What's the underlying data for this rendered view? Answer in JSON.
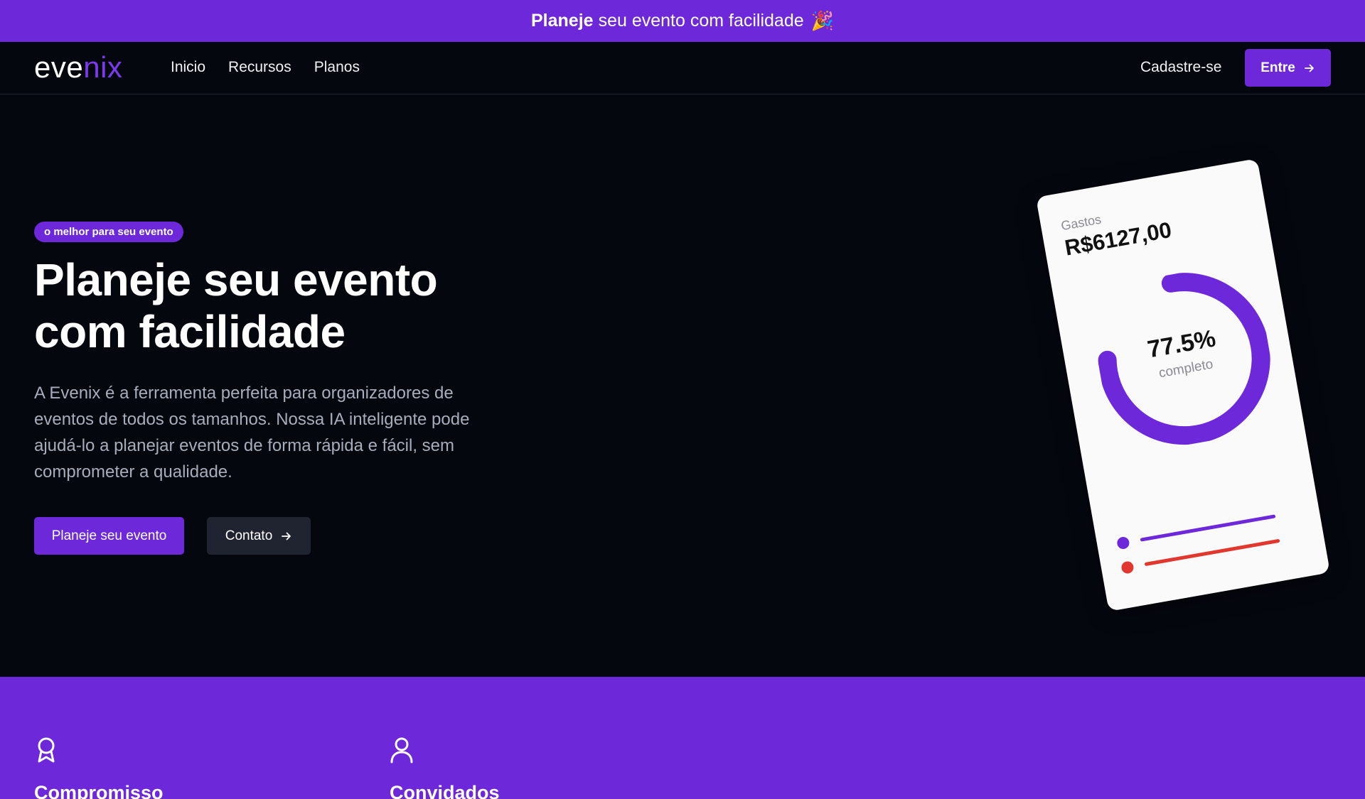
{
  "announcement": {
    "bold": "Planeje",
    "text": "seu evento com facilidade",
    "emoji": "🎉"
  },
  "nav": {
    "logo_part1": "eve",
    "logo_part2": "nix",
    "links": [
      "Inicio",
      "Recursos",
      "Planos"
    ],
    "signup": "Cadastre-se",
    "login": "Entre"
  },
  "hero": {
    "badge": "o melhor para seu evento",
    "title_line1": "Planeje seu evento",
    "title_line2": "com facilidade",
    "description": "A Evenix é a ferramenta perfeita para organizadores de eventos de todos os tamanhos. Nossa IA inteligente pode ajudá-lo a planejar eventos de forma rápida e fácil, sem comprometer a qualidade.",
    "primary_button": "Planeje seu evento",
    "secondary_button": "Contato"
  },
  "card": {
    "label": "Gastos",
    "amount": "R$6127,00",
    "percent_label": "77.5%",
    "percent_value": 77.5,
    "sub_label": "completo",
    "accent": "#6d28d9",
    "legend_colors": [
      "#6d28d9",
      "#e0382e"
    ]
  },
  "features": [
    {
      "icon": "award-icon",
      "title": "Compromisso"
    },
    {
      "icon": "user-icon",
      "title": "Convidados"
    }
  ],
  "colors": {
    "brand": "#6d28d9",
    "background": "#05070f",
    "secondary_button": "#1f2430"
  }
}
